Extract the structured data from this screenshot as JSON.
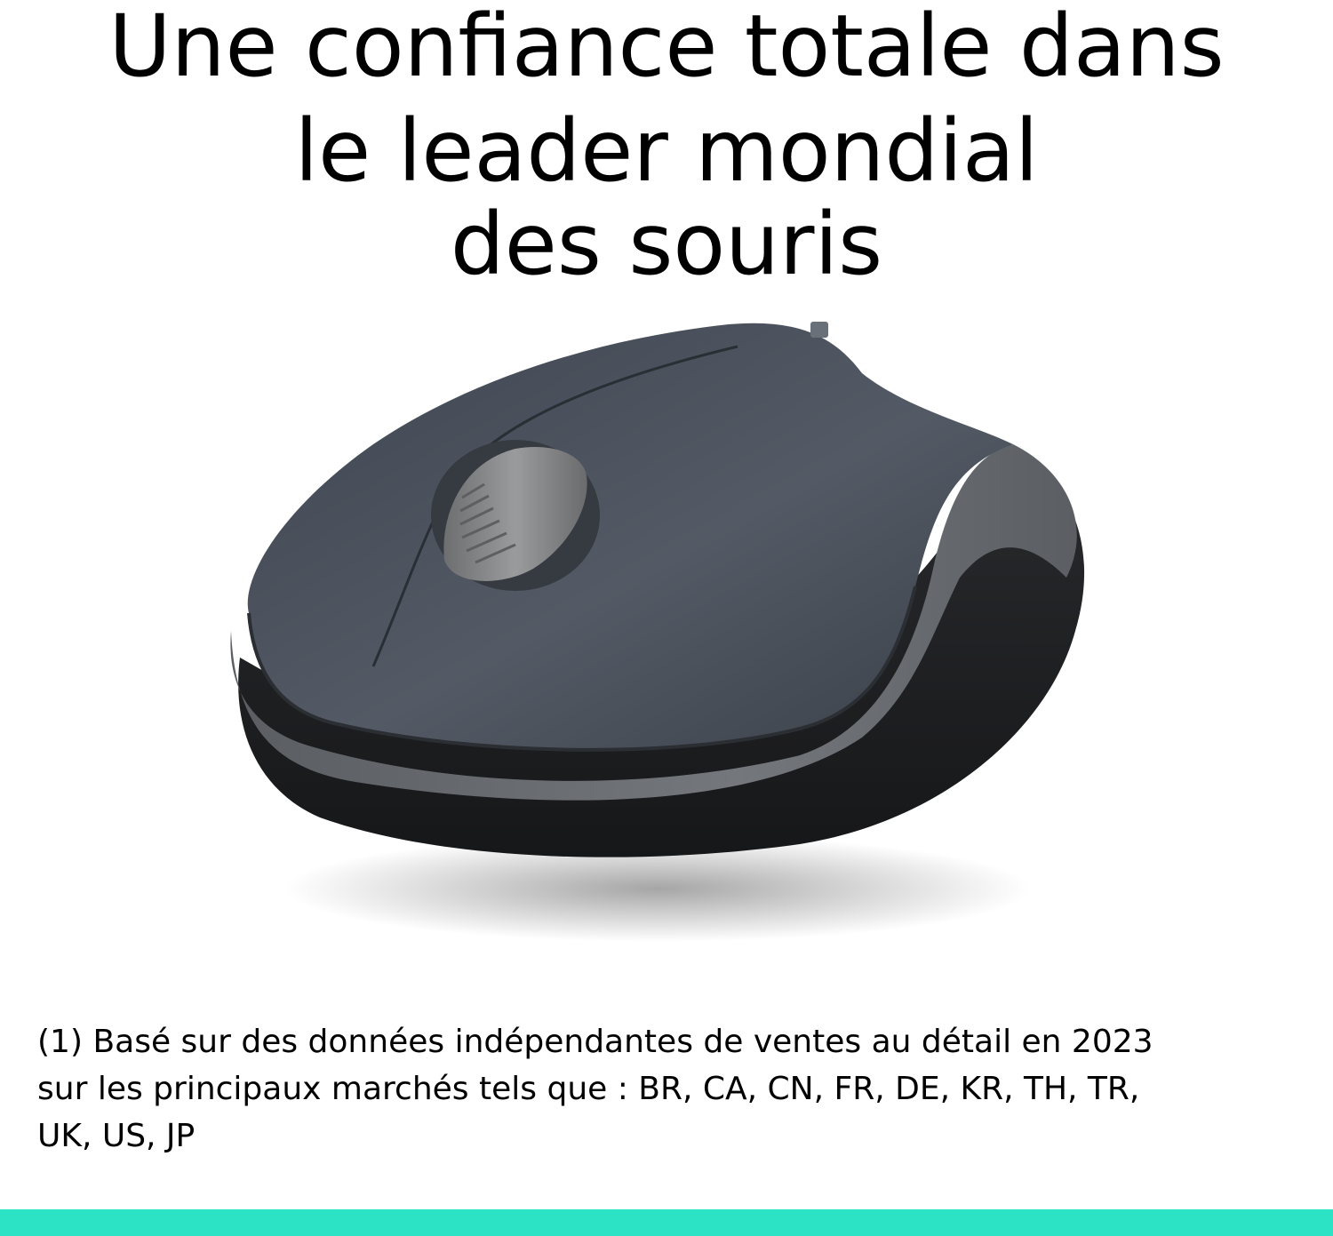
{
  "headline": {
    "line1": "Une confiance totale dans",
    "line2": "le leader mondial",
    "line3": "des souris"
  },
  "footnote": {
    "line1": "(1) Basé sur des données indépendantes de ventes au détail en 2023",
    "line2": "sur les principaux marchés tels que : BR, CA, CN, FR, DE, KR, TH, TR,",
    "line3": "UK, US, JP"
  },
  "colors": {
    "accent_bar": "#2de3c6",
    "mouse_top": "#4b515b",
    "mouse_side_band": "#6b6e73",
    "mouse_base": "#1e1f21",
    "scroll_wheel": "#8a8b8d"
  },
  "icons": {
    "product": "wireless-mouse"
  }
}
